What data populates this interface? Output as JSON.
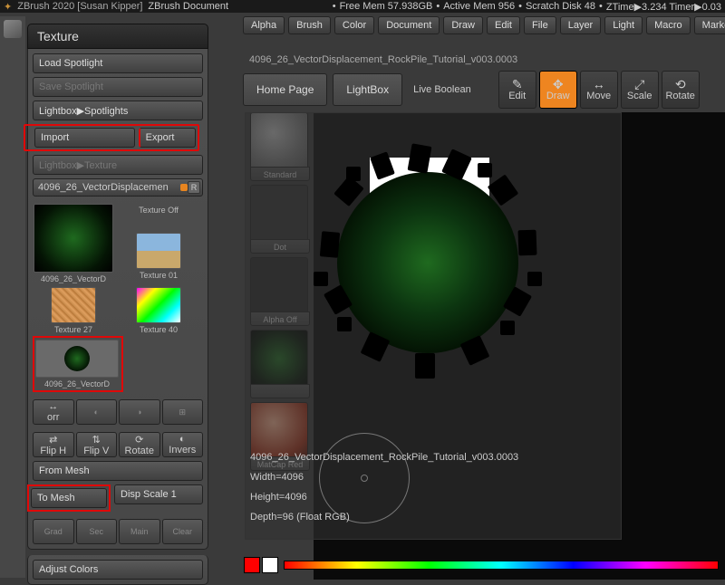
{
  "titlebar": {
    "app": "ZBrush 2020 [Susan Kipper]",
    "doc": "ZBrush Document"
  },
  "status": {
    "freemem": "Free Mem 57.938GB",
    "activemem": "Active Mem 956",
    "scratch": "Scratch Disk 48",
    "ztime": "ZTime▶3.234 Timer▶0.03"
  },
  "menu": [
    "Alpha",
    "Brush",
    "Color",
    "Document",
    "Draw",
    "Edit",
    "File",
    "Layer",
    "Light",
    "Macro",
    "Marker"
  ],
  "docname": "4096_26_VectorDisplacement_RockPile_Tutorial_v003.0003",
  "toolbar": {
    "home": "Home Page",
    "lightbox": "LightBox",
    "livebool": "Live Boolean"
  },
  "modes": [
    "Edit",
    "Draw",
    "Move",
    "Scale",
    "Rotate"
  ],
  "active_mode": "Draw",
  "panel": {
    "title": "Texture",
    "load_spotlight": "Load Spotlight",
    "save_spotlight": "Save Spotlight",
    "lightbox_spotlights": "Lightbox▶Spotlights",
    "import": "Import",
    "export": "Export",
    "lightbox_texture": "Lightbox▶Texture",
    "current_tex": "4096_26_VectorDisplacemen",
    "textures": [
      {
        "label": "4096_26_VectorD"
      },
      {
        "label": "Texture Off"
      },
      {
        "label": "Texture 01"
      },
      {
        "label": "Texture 27"
      },
      {
        "label": "Texture 40"
      },
      {
        "label": "4096_26_VectorD"
      }
    ],
    "small": [
      "Flip H",
      "Flip V",
      "Rotate",
      "Invers"
    ],
    "corr_label": "orr",
    "from_mesh": "From Mesh",
    "to_mesh": "To Mesh",
    "disp_scale": "Disp Scale 1",
    "bottom": [
      "Grad",
      "Sec",
      "Main",
      "Clear"
    ],
    "adjust": "Adjust Colors"
  },
  "rightcol": [
    {
      "label": "Standard",
      "bg": "radial-gradient(circle at 40% 35%,#bbb,#777 60%,#555)"
    },
    {
      "label": "Dot",
      "bg": "#333"
    },
    {
      "label": "Alpha Off",
      "bg": "#2a2a2a"
    },
    {
      "label": "",
      "bg": "radial-gradient(circle,#1f6a1f,#041404 70%,#000)"
    },
    {
      "label": "MatCap Red Wax",
      "bg": "radial-gradient(circle at 40% 35%,#f3b090,#a03018 70%,#4a1005)"
    }
  ],
  "popup": {
    "name": "4096_26_VectorDisplacement_RockPile_Tutorial_v003.0003",
    "width": "Width=4096",
    "height": "Height=4096",
    "depth": "Depth=96 (Float RGB)"
  }
}
